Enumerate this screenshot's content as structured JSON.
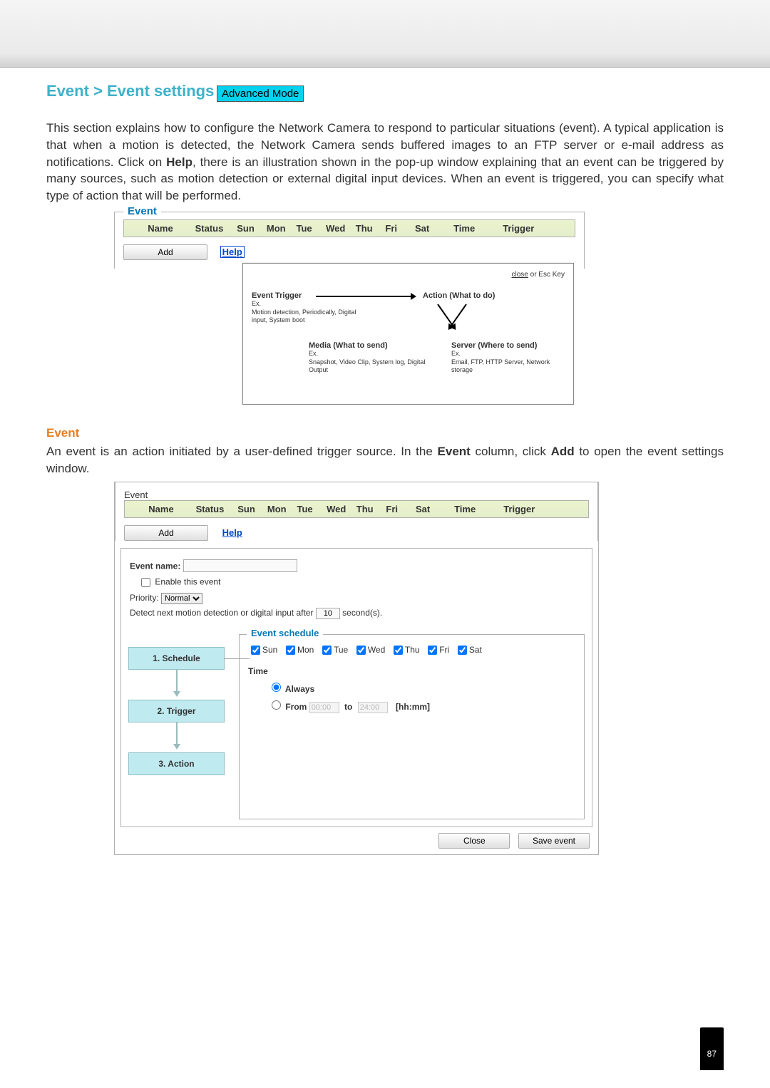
{
  "heading": {
    "breadcrumb": "Event > Event settings",
    "badge": "Advanced Mode"
  },
  "intro": {
    "text_before_help": "This section explains how to configure the Network Camera to respond to particular situations (event). A typical application is that when a motion is detected, the Network Camera sends buffered images to an FTP server or e-mail address as notifications. Click on ",
    "help_word": "Help",
    "text_after_help": ", there is an illustration shown in the pop-up window explaining that an event can be triggered by many sources, such as motion detection or external digital input devices. When an event is triggered, you can specify what type of action that will be performed."
  },
  "fig1": {
    "legend": "Event",
    "headers": {
      "name": "Name",
      "status": "Status",
      "sun": "Sun",
      "mon": "Mon",
      "tue": "Tue",
      "wed": "Wed",
      "thu": "Thu",
      "fri": "Fri",
      "sat": "Sat",
      "time": "Time",
      "trigger": "Trigger"
    },
    "add_btn": "Add",
    "help_link": "Help",
    "popup": {
      "close_text": "close",
      "close_suffix": " or Esc Key",
      "trigger_title": "Event Trigger",
      "trigger_ex_label": "Ex.",
      "trigger_ex": "Motion detection, Periodically, Digital input, System boot",
      "action_title": "Action (What to do)",
      "media_title": "Media (What to send)",
      "media_ex_label": "Ex.",
      "media_ex": "Snapshot, Video Clip, System log, Digital Output",
      "server_title": "Server (Where to send)",
      "server_ex_label": "Ex.",
      "server_ex": "Email, FTP, HTTP Server, Network storage"
    }
  },
  "section": {
    "title": "Event",
    "para_before_event": "An event is an action initiated by a user-defined trigger source. In the ",
    "event_word": "Event",
    "para_mid": " column, click ",
    "add_word": "Add",
    "para_after": " to open the event settings window."
  },
  "fig2": {
    "legend": "Event",
    "headers": {
      "name": "Name",
      "status": "Status",
      "sun": "Sun",
      "mon": "Mon",
      "tue": "Tue",
      "wed": "Wed",
      "thu": "Thu",
      "fri": "Fri",
      "sat": "Sat",
      "time": "Time",
      "trigger": "Trigger"
    },
    "add_btn": "Add",
    "help_link": "Help",
    "form": {
      "event_name_label": "Event name:",
      "event_name_value": "",
      "enable_label": "Enable this event",
      "enable_checked": false,
      "priority_label": "Priority:",
      "priority_value": "Normal",
      "detect_prefix": "Detect next motion detection or digital input after",
      "detect_value": "10",
      "detect_suffix": "second(s)."
    },
    "steps": {
      "s1": "1.  Schedule",
      "s2": "2.  Trigger",
      "s3": "3.  Action"
    },
    "schedule": {
      "legend": "Event schedule",
      "days": {
        "sun": "Sun",
        "mon": "Mon",
        "tue": "Tue",
        "wed": "Wed",
        "thu": "Thu",
        "fri": "Fri",
        "sat": "Sat"
      },
      "time_label": "Time",
      "always": "Always",
      "from_label": "From",
      "from_value": "00:00",
      "to_label": "to",
      "to_value": "24:00",
      "hhmm": "[hh:mm]",
      "time_mode": "always"
    },
    "buttons": {
      "close": "Close",
      "save": "Save event"
    }
  },
  "page_number": "87"
}
